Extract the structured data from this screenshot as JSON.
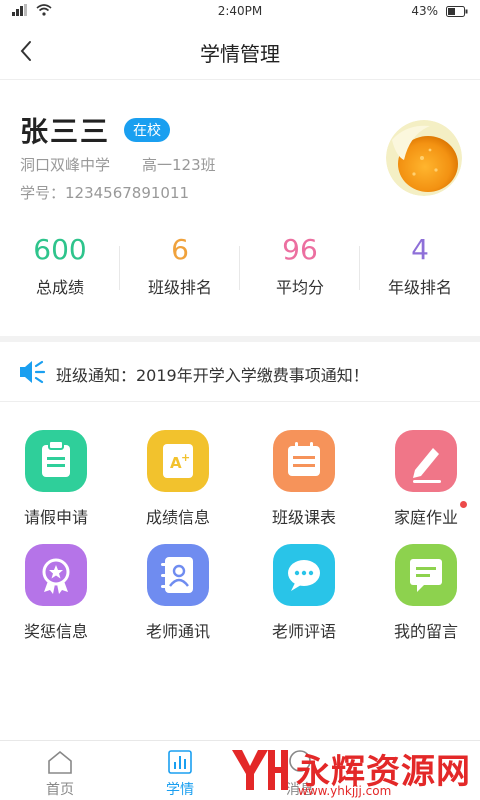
{
  "status_bar": {
    "time": "2:40PM",
    "battery": "43%"
  },
  "header": {
    "title": "学情管理"
  },
  "profile": {
    "name": "张三三",
    "status_badge": "在校",
    "school": "洞口双峰中学",
    "class_name": "高一123班",
    "student_id": "学号：1234567891011"
  },
  "stats": [
    {
      "value": "600",
      "label": "总成绩",
      "color": "#2ec48c"
    },
    {
      "value": "6",
      "label": "班级排名",
      "color": "#f0a23c"
    },
    {
      "value": "96",
      "label": "平均分",
      "color": "#ec6fa0"
    },
    {
      "value": "4",
      "label": "年级排名",
      "color": "#8e6fd8"
    }
  ],
  "notice": {
    "text": "班级通知：2019年开学入学缴费事项通知！"
  },
  "grid": [
    {
      "label": "请假申请",
      "icon": "leave-request-icon",
      "color": "#2fcf9a"
    },
    {
      "label": "成绩信息",
      "icon": "grade-info-icon",
      "color": "#f2c22d"
    },
    {
      "label": "班级课表",
      "icon": "class-schedule-icon",
      "color": "#f6935a"
    },
    {
      "label": "家庭作业",
      "icon": "homework-icon",
      "color": "#f07688"
    },
    {
      "label": "奖惩信息",
      "icon": "reward-icon",
      "color": "#b574e8"
    },
    {
      "label": "老师通讯",
      "icon": "teacher-contact-icon",
      "color": "#6f8cf0"
    },
    {
      "label": "老师评语",
      "icon": "teacher-comment-icon",
      "color": "#29c4e8"
    },
    {
      "label": "我的留言",
      "icon": "my-message-icon",
      "color": "#8dd24e"
    }
  ],
  "tab_bar": [
    {
      "label": "首页",
      "active": false
    },
    {
      "label": "学情",
      "active": true
    },
    {
      "label": "消息",
      "active": false
    },
    {
      "label": "",
      "active": false
    }
  ],
  "watermark": {
    "title": "永辉资源网",
    "url": "www.yhkjjj.com"
  },
  "accent_color": "#1a9ff0"
}
